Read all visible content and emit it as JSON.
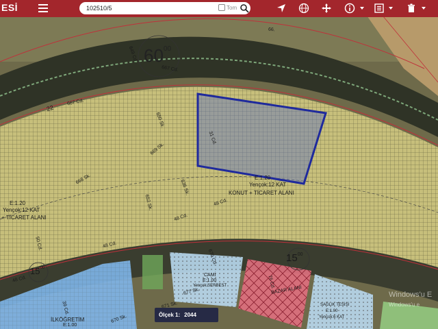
{
  "app": {
    "title": "ESİ"
  },
  "search": {
    "value": "102510/5",
    "all_label": "Tom"
  },
  "scale": {
    "label": "Ölçek 1:",
    "value": "2044"
  },
  "map_labels": {
    "num_60": "60",
    "num_60_sup": "00",
    "num_15_left": "15",
    "num_15_left_sup": "00",
    "num_15_right": "15",
    "num_15_right_sup": "00",
    "cd_649": "649 Cd.",
    "cd_667_top": "667 Cd.",
    "cd_667_left": "667 Cd.",
    "cd_66": "66.",
    "sk_650": "650 Sk.",
    "sk_669": "669 Sk.",
    "sk_668": "668 Sk.",
    "sk_636": "636 Sk.",
    "sk_652": "652 Sk.",
    "cd_48_a": "48 Cd.",
    "cd_48_b": "48 Cd.",
    "cd_48_c": "48 Cd.",
    "cd_48_d": "48 Cd.",
    "cd_679": "679 Cd.",
    "cd_677": "677 Sk.",
    "cd_670": "670 Sk.",
    "cd_671": "671 Sk.",
    "cd_39": "39 Cd.",
    "cd_76": "76 Cd.",
    "cd_50": "50 Cd.",
    "cd_31": "31 Cd.",
    "num_22": "22",
    "e120_right": "E:1.20",
    "yencok_right": "Yençok:12 KAT",
    "konut_right": "KONUT + TİCARET ALANI",
    "e120_left": "E:1.20",
    "yencok_left": "Yençok:12 KAT",
    "ticaret_left": "+ TİCARET ALANI",
    "cami": "CAMİ",
    "cami_e": "E:1.00",
    "cami_sub": "Yençok:SERBEST",
    "bazar": "BAZAR ALANI",
    "saglik": "SAĞLIK TESİSİ",
    "saglik_e": "E:1.00",
    "saglik_sub": "Yençok:6 KAT",
    "ilkogretim": "İLKÖĞRETİM",
    "ilk_e": "E:1.00",
    "windows_1": "Windows'u E",
    "windows_2": "Windows'u e"
  },
  "colors": {
    "topbar": "#a3262c",
    "selection": "#1f2a9c",
    "zone_yellow": "#e6dc8c",
    "zone_blue": "#7fb6ea",
    "zone_red": "#e07080",
    "zone_lightblue": "#b8d8ee"
  },
  "icons": [
    "menu-icon",
    "search-icon",
    "location-arrow-icon",
    "globe-icon",
    "move-icon",
    "info-icon",
    "layers-icon",
    "trash-icon"
  ]
}
